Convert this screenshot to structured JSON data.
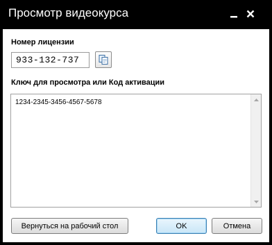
{
  "window": {
    "title": "Просмотр видеокурса"
  },
  "license": {
    "label": "Номер лицензии",
    "value": "933-132-737",
    "copy_icon": "copy-icon"
  },
  "key": {
    "label": "Ключ для просмотра или Код активации",
    "value": "1234-2345-3456-4567-5678"
  },
  "buttons": {
    "back": "Вернуться на рабочий стол",
    "ok": "OK",
    "cancel": "Отмена"
  },
  "colors": {
    "titlebar": "#000000",
    "client": "#ffffff",
    "default_button_border": "#3c7fb1"
  }
}
